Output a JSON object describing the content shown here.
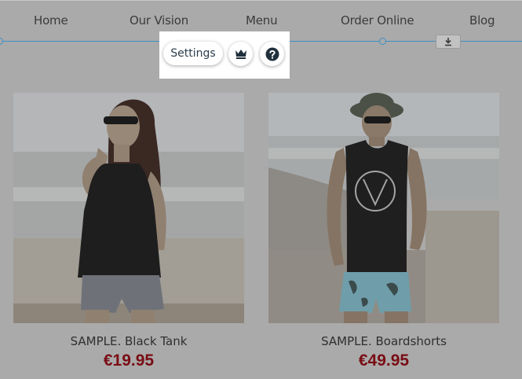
{
  "nav": {
    "items": [
      {
        "label": "Home"
      },
      {
        "label": "Our Vision"
      },
      {
        "label": "Menu"
      },
      {
        "label": "Order Online"
      },
      {
        "label": "Blog"
      }
    ]
  },
  "toolbar": {
    "settings_label": "Settings",
    "crown_icon": "crown-icon",
    "help_icon": "question-icon",
    "download_icon": "download-icon"
  },
  "products": [
    {
      "name": "SAMPLE. Black Tank",
      "price": "€19.95"
    },
    {
      "name": "SAMPLE. Boardshorts",
      "price": "€49.95"
    }
  ],
  "colors": {
    "overlay": "#aaaaaa",
    "guide": "#3d8fc4",
    "price": "#7a0d14"
  }
}
